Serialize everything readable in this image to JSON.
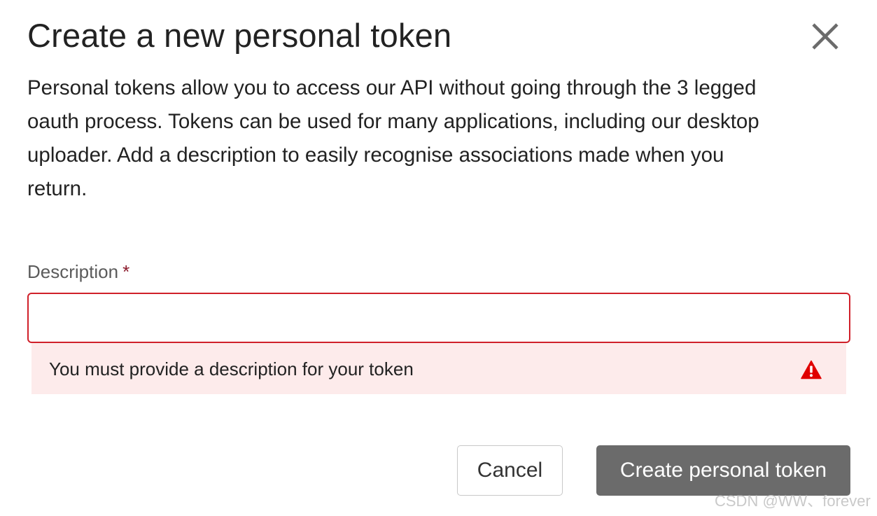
{
  "dialog": {
    "title": "Create a new personal token",
    "close_icon": "close-icon",
    "intro": "Personal tokens allow you to access our API without going through the 3 legged oauth process. Tokens can be used for many applications, including our desktop uploader. Add a description to easily recognise associations made when you return."
  },
  "form": {
    "description_label": "Description",
    "required_marker": "*",
    "description_value": "",
    "description_placeholder": "",
    "error_message": "You must provide a description for your token",
    "error_icon": "warning-triangle-icon"
  },
  "actions": {
    "cancel_label": "Cancel",
    "create_label": "Create personal token"
  },
  "watermark": "CSDN @WW、forever",
  "colors": {
    "error_border": "#d0202a",
    "error_background": "#fdebeb",
    "error_icon": "#e00000",
    "primary_button": "#6b6b6b",
    "required_marker": "#8b1a2b"
  }
}
